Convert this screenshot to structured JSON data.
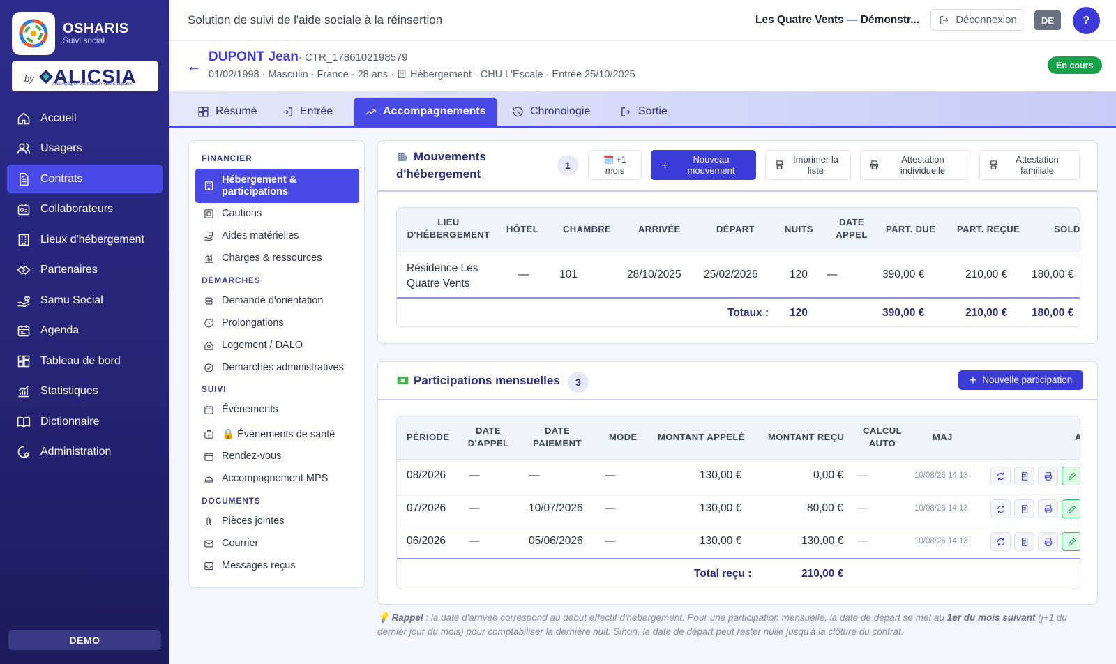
{
  "app": {
    "name": "OSHARIS",
    "subtitle": "Suivi social",
    "partner_by": "by",
    "partner_brand": "ALICSIA",
    "partner_tagline": "Accompagner vos transformations digitales",
    "demo_label": "DEMO"
  },
  "nav": [
    {
      "label": "Accueil",
      "icon": "home-icon"
    },
    {
      "label": "Usagers",
      "icon": "users-icon"
    },
    {
      "label": "Contrats",
      "icon": "document-icon",
      "active": true
    },
    {
      "label": "Collaborateurs",
      "icon": "badge-icon"
    },
    {
      "label": "Lieux d'hébergement",
      "icon": "building-icon"
    },
    {
      "label": "Partenaires",
      "icon": "handshake-icon"
    },
    {
      "label": "Samu Social",
      "icon": "hand-heart-icon"
    },
    {
      "label": "Agenda",
      "icon": "calendar-icon"
    },
    {
      "label": "Tableau de bord",
      "icon": "dashboard-icon"
    },
    {
      "label": "Statistiques",
      "icon": "stats-icon"
    },
    {
      "label": "Dictionnaire",
      "icon": "book-icon"
    },
    {
      "label": "Administration",
      "icon": "settings-icon"
    }
  ],
  "topbar": {
    "title": "Solution de suivi de l'aide sociale à la réinsertion",
    "org": "Les Quatre Vents — Démonstr...",
    "logout": "Déconnexion",
    "lang": "DE",
    "help": "?"
  },
  "person": {
    "back": "←",
    "name": "DUPONT Jean",
    "ref": "· CTR_1786102198579",
    "meta_left": "01/02/1998 · Masculin · France · 28 ans · ",
    "meta_right": "Hébergement · CHU L'Escale · Entrée 25/10/2025",
    "status": "En cours"
  },
  "tabs": [
    {
      "label": "Résumé",
      "icon": "grid-icon"
    },
    {
      "label": "Entrée",
      "icon": "login-icon"
    },
    {
      "label": "Accompagnements",
      "icon": "trend-icon",
      "active": true
    },
    {
      "label": "Chronologie",
      "icon": "history-icon"
    },
    {
      "label": "Sortie",
      "icon": "logout-icon"
    }
  ],
  "submenu": {
    "sections": {
      "financier": "FINANCIER",
      "demarches": "DÉMARCHES",
      "suivi": "SUIVI",
      "documents": "DOCUMENTS"
    },
    "items": {
      "hebergement": "Hébergement & participations",
      "cautions": "Cautions",
      "aides": "Aides matérielles",
      "charges": "Charges & ressources",
      "orientation": "Demande d'orientation",
      "prolongations": "Prolongations",
      "logement": "Logement / DALO",
      "admin": "Démarches administratives",
      "evenements": "Événements",
      "sante": "🔒 Évènements de santé",
      "rdv": "Rendez-vous",
      "mps": "Accompagnement MPS",
      "pieces": "Pièces jointes",
      "courrier": "Courrier",
      "messages": "Messages reçus"
    }
  },
  "mouvements": {
    "title_line1": "Mouvements",
    "title_line2": "d'hébergement",
    "count": "1",
    "btn_month_l1": "+1",
    "btn_month_l2": "mois",
    "btn_new_l1": "Nouveau",
    "btn_new_l2": "mouvement",
    "btn_print_l1": "Imprimer la",
    "btn_print_l2": "liste",
    "btn_att_ind_l1": "Attestation",
    "btn_att_ind_l2": "individuelle",
    "btn_att_fam_l1": "Attestation",
    "btn_att_fam_l2": "familiale",
    "headers": {
      "lieu1": "LIEU",
      "lieu2": "D'HÉBERGEMENT",
      "hotel": "HÔTEL",
      "chambre": "CHAMBRE",
      "arrivee": "ARRIVÉE",
      "depart": "DÉPART",
      "nuits": "NUITS",
      "date1": "DATE",
      "date2": "APPEL",
      "part_due": "PART. DUE",
      "part_recue": "PART. REÇUE",
      "solde": "SOLD"
    },
    "row": {
      "lieu1": "Résidence Les",
      "lieu2": "Quatre Vents",
      "hotel": "—",
      "chambre": "101",
      "arrivee": "28/10/2025",
      "depart": "25/02/2026",
      "nuits": "120",
      "date_appel": "—",
      "part_due": "390,00 €",
      "part_recue": "210,00 €",
      "solde": "180,00 €"
    },
    "totals": {
      "label": "Totaux :",
      "nuits": "120",
      "part_due": "390,00 €",
      "part_recue": "210,00 €",
      "solde": "180,00 €"
    }
  },
  "participations": {
    "title": "Participations mensuelles",
    "count": "3",
    "btn_new": "Nouvelle participation",
    "headers": {
      "periode": "PÉRIODE",
      "date_appel1": "DATE",
      "date_appel2": "D'APPEL",
      "date_paiement1": "DATE",
      "date_paiement2": "PAIEMENT",
      "mode": "MODE",
      "montant_appele": "MONTANT APPELÉ",
      "montant_recu": "MONTANT REÇU",
      "calcul1": "CALCUL",
      "calcul2": "AUTO",
      "maj": "MAJ",
      "actions": "A"
    },
    "rows": [
      {
        "periode": "08/2026",
        "date_appel": "—",
        "date_paiement": "—",
        "mode": "—",
        "montant_appele": "130,00 €",
        "montant_recu": "0,00 €",
        "calcul": "—",
        "maj": "10/08/26 14:13"
      },
      {
        "periode": "07/2026",
        "date_appel": "—",
        "date_paiement": "10/07/2026",
        "mode": "—",
        "montant_appele": "130,00 €",
        "montant_recu": "80,00 €",
        "calcul": "—",
        "maj": "10/08/26 14:13"
      },
      {
        "periode": "06/2026",
        "date_appel": "—",
        "date_paiement": "05/06/2026",
        "mode": "—",
        "montant_appele": "130,00 €",
        "montant_recu": "130,00 €",
        "calcul": "—",
        "maj": "10/08/26 14:13"
      }
    ],
    "total_label": "Total reçu :",
    "total_value": "210,00 €"
  },
  "rappel": {
    "icon": "💡",
    "label": "Rappel",
    "text1": " : la date d'arrivée correspond au début effectif d'hébergement. Pour une participation mensuelle, la date de départ se met au ",
    "bold": "1er du mois suivant",
    "text2": " (j+1 du dernier jour du mois) pour comptabiliser la dernière nuit. Sinon, la date de départ peut rester nulle jusqu'à la clôture du contrat."
  },
  "colors": {
    "primary": "#3b3bd8",
    "sidebar": "#2c2c8c",
    "success": "#16a34a"
  }
}
